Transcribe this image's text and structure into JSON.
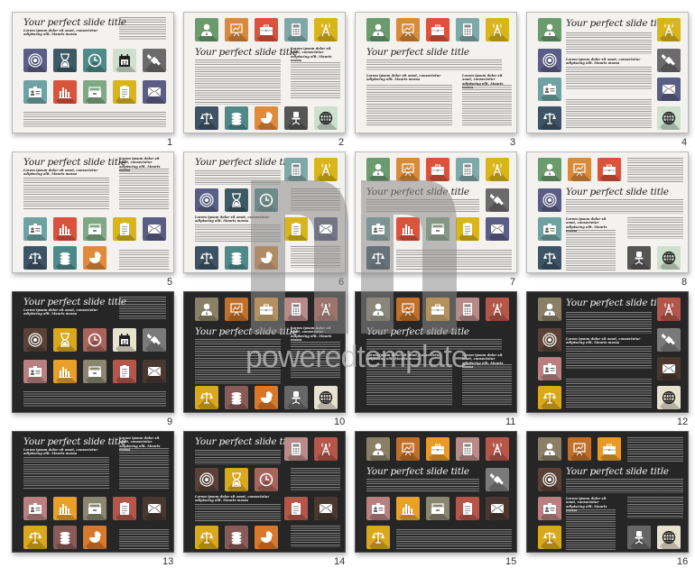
{
  "gallery": {
    "slide_title": "Your perfect slide title",
    "subheading": "Lorem ipsum dolor sit amet, consectetur adipiscing elit. Mauris massa",
    "slides": [
      {
        "number": "1",
        "theme": "light"
      },
      {
        "number": "2",
        "theme": "light"
      },
      {
        "number": "3",
        "theme": "light"
      },
      {
        "number": "4",
        "theme": "light"
      },
      {
        "number": "5",
        "theme": "light"
      },
      {
        "number": "6",
        "theme": "light"
      },
      {
        "number": "7",
        "theme": "light"
      },
      {
        "number": "8",
        "theme": "light"
      },
      {
        "number": "9",
        "theme": "dark"
      },
      {
        "number": "10",
        "theme": "dark"
      },
      {
        "number": "11",
        "theme": "dark"
      },
      {
        "number": "12",
        "theme": "dark"
      },
      {
        "number": "13",
        "theme": "dark"
      },
      {
        "number": "14",
        "theme": "dark"
      },
      {
        "number": "15",
        "theme": "dark"
      },
      {
        "number": "16",
        "theme": "dark"
      }
    ]
  },
  "icons": {
    "target": {
      "light": "#5a5e86",
      "dark": "#5a4238"
    },
    "hourglass": {
      "light": "#3d5a66",
      "dark": "#d9a81c"
    },
    "clock": {
      "light": "#4e8a8a",
      "dark": "#a8645a"
    },
    "calendar": {
      "light": "#cfe0cf",
      "dark": "#e8e2d0"
    },
    "satellite": {
      "light": "#6b6b6b",
      "dark": "#7a7a7a"
    },
    "id-card": {
      "light": "#6fa3a3",
      "dark": "#b88080"
    },
    "bar-chart": {
      "light": "#d9533d",
      "dark": "#e8a028"
    },
    "archive": {
      "light": "#7fa884",
      "dark": "#8a8670"
    },
    "clipboard": {
      "light": "#d9b51c",
      "dark": "#b4574a"
    },
    "mail": {
      "light": "#5a5e86",
      "dark": "#4a3830"
    },
    "user": {
      "light": "#6a9c6e",
      "dark": "#8a8066"
    },
    "presentation": {
      "light": "#d98a3a",
      "dark": "#c0702a"
    },
    "briefcase": {
      "light": "#d9533d",
      "dark": "#e89a28"
    },
    "calculator": {
      "light": "#7fa8a8",
      "dark": "#b88a88"
    },
    "antenna": {
      "light": "#d9b51c",
      "dark": "#b4574a"
    },
    "scales": {
      "light": "#3d5366",
      "dark": "#d9a81c"
    },
    "coins": {
      "light": "#4e8a8a",
      "dark": "#8a5a58"
    },
    "pie-chart": {
      "light": "#e08a3a",
      "dark": "#d9782a"
    },
    "office-chair": {
      "light": "#555555",
      "dark": "#666666"
    },
    "globe": {
      "light": "#cfe0cf",
      "dark": "#e8e2d0"
    }
  },
  "watermark": {
    "text": "poweredtemplate",
    "color": "#9a9a9a"
  }
}
